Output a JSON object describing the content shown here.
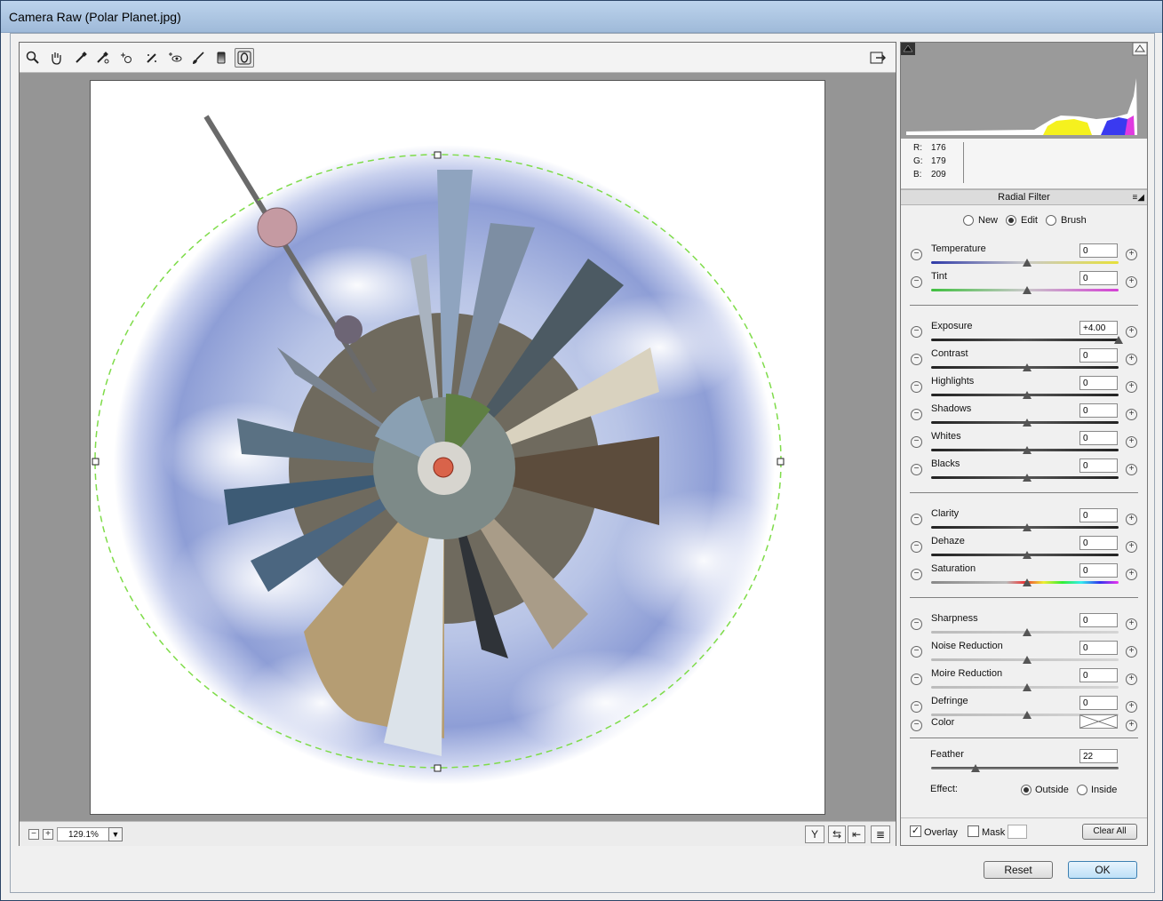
{
  "window": {
    "title": "Camera Raw (Polar Planet.jpg)"
  },
  "toolbar": {
    "tools": [
      "zoom-tool-icon",
      "hand-tool-icon",
      "white-balance-tool-icon",
      "color-sampler-tool-icon",
      "targeted-adjustment-tool-icon",
      "spot-removal-tool-icon",
      "red-eye-removal-tool-icon",
      "adjustment-brush-icon",
      "graduated-filter-icon",
      "radial-filter-icon"
    ],
    "selected": "radial-filter-icon",
    "open_preferences_icon": "toggle-fullscreen-icon"
  },
  "status": {
    "zoom": "129.1%"
  },
  "histogram": {
    "r_label": "R:",
    "g_label": "G:",
    "b_label": "B:",
    "r": "176",
    "g": "179",
    "b": "209"
  },
  "panel": {
    "title": "Radial Filter",
    "modes": [
      {
        "label": "New",
        "selected": false
      },
      {
        "label": "Edit",
        "selected": true
      },
      {
        "label": "Brush",
        "selected": false
      }
    ],
    "groups": [
      [
        {
          "label": "Temperature",
          "value": "0",
          "pos": 0.5,
          "track": "temp"
        },
        {
          "label": "Tint",
          "value": "0",
          "pos": 0.5,
          "track": "tint"
        }
      ],
      [
        {
          "label": "Exposure",
          "value": "+4.00",
          "pos": 1.0,
          "track": "dark"
        },
        {
          "label": "Contrast",
          "value": "0",
          "pos": 0.5,
          "track": "dark"
        },
        {
          "label": "Highlights",
          "value": "0",
          "pos": 0.5,
          "track": "dark"
        },
        {
          "label": "Shadows",
          "value": "0",
          "pos": 0.5,
          "track": "dark"
        },
        {
          "label": "Whites",
          "value": "0",
          "pos": 0.5,
          "track": "dark"
        },
        {
          "label": "Blacks",
          "value": "0",
          "pos": 0.5,
          "track": "dark"
        }
      ],
      [
        {
          "label": "Clarity",
          "value": "0",
          "pos": 0.5,
          "track": "dark"
        },
        {
          "label": "Dehaze",
          "value": "0",
          "pos": 0.5,
          "track": "dark"
        },
        {
          "label": "Saturation",
          "value": "0",
          "pos": 0.5,
          "track": "sat"
        }
      ],
      [
        {
          "label": "Sharpness",
          "value": "0",
          "pos": 0.5,
          "track": "light"
        },
        {
          "label": "Noise Reduction",
          "value": "0",
          "pos": 0.5,
          "track": "light"
        },
        {
          "label": "Moire Reduction",
          "value": "0",
          "pos": 0.5,
          "track": "light"
        },
        {
          "label": "Defringe",
          "value": "0",
          "pos": 0.5,
          "track": "light"
        }
      ]
    ],
    "color_label": "Color",
    "feather_label": "Feather",
    "feather_value": "22",
    "feather_pos": 0.22,
    "effect_label": "Effect:",
    "effect_outside": "Outside",
    "effect_inside": "Inside",
    "effect_selected": "Outside",
    "overlay_label": "Overlay",
    "overlay_checked": true,
    "mask_label": "Mask",
    "mask_checked": false,
    "clear_all": "Clear All"
  },
  "footer": {
    "reset": "Reset",
    "ok": "OK"
  },
  "colors": {
    "filter_outline": "#7fdc4a",
    "center_pin": "#d9634a"
  }
}
